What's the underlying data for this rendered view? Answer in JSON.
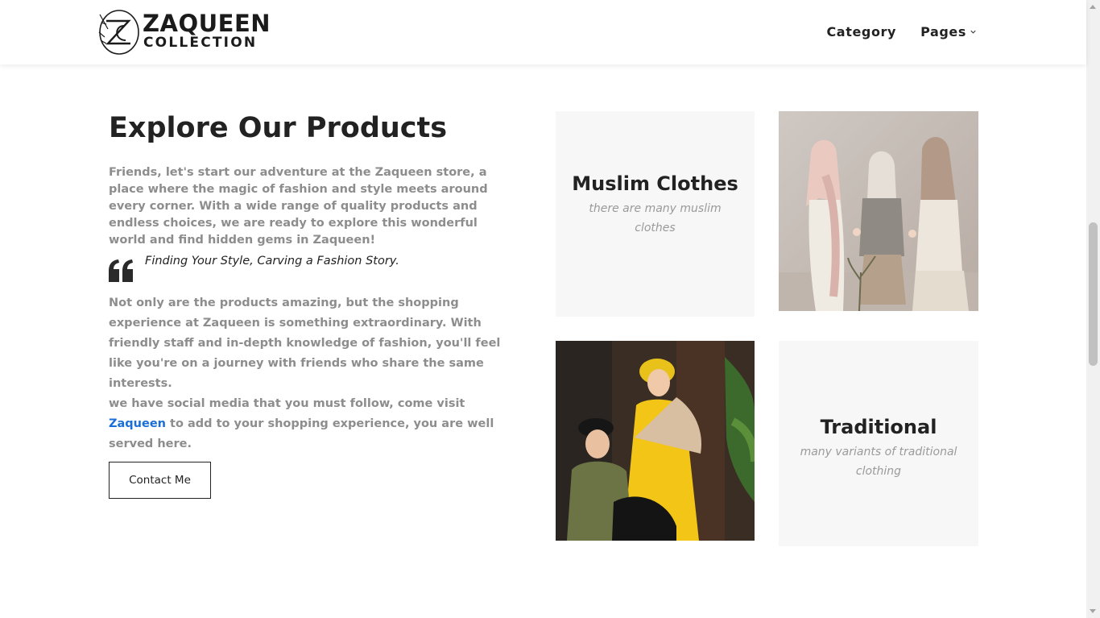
{
  "header": {
    "logo": {
      "line1": "ZAQUEEN",
      "line2": "COLLECTION",
      "icon": "zc-monogram-logo"
    },
    "nav": [
      {
        "label": "Category",
        "has_dropdown": false
      },
      {
        "label": "Pages",
        "has_dropdown": true
      }
    ]
  },
  "main": {
    "title": "Explore Our Products",
    "intro": "Friends, let's start our adventure at the Zaqueen store, a place where the magic of fashion and style meets around every corner. With a wide range of quality products and endless choices, we are ready to explore this wonderful world and find hidden gems in Zaqueen!",
    "quote": "Finding Your Style, Carving a Fashion Story.",
    "quote_icon": "quote-icon",
    "body": "Not only are the products amazing, but the shopping experience at Zaqueen is something extraordinary. With friendly staff and in-depth knowledge of fashion, you'll feel like you're on a journey with friends who share the same interests.",
    "social": {
      "before": "we have social media that you must follow, come visit ",
      "link": "Zaqueen",
      "after": " to add to your shopping experience, you are well served here."
    },
    "contact_button": "Contact Me"
  },
  "products": [
    {
      "title": "Muslim Clothes",
      "subtitle": "there are many muslim clothes"
    },
    {
      "image": "three women in hijab holding hands"
    },
    {
      "image": "couple in traditional yellow and green clothing with fans"
    },
    {
      "title": "Traditional",
      "subtitle": "many variants of traditional clothing"
    }
  ],
  "colors": {
    "accent_link": "#1a6ed8",
    "muted_text": "#8d8d8d",
    "card_bg": "#f7f7f7",
    "heading": "#222222"
  }
}
